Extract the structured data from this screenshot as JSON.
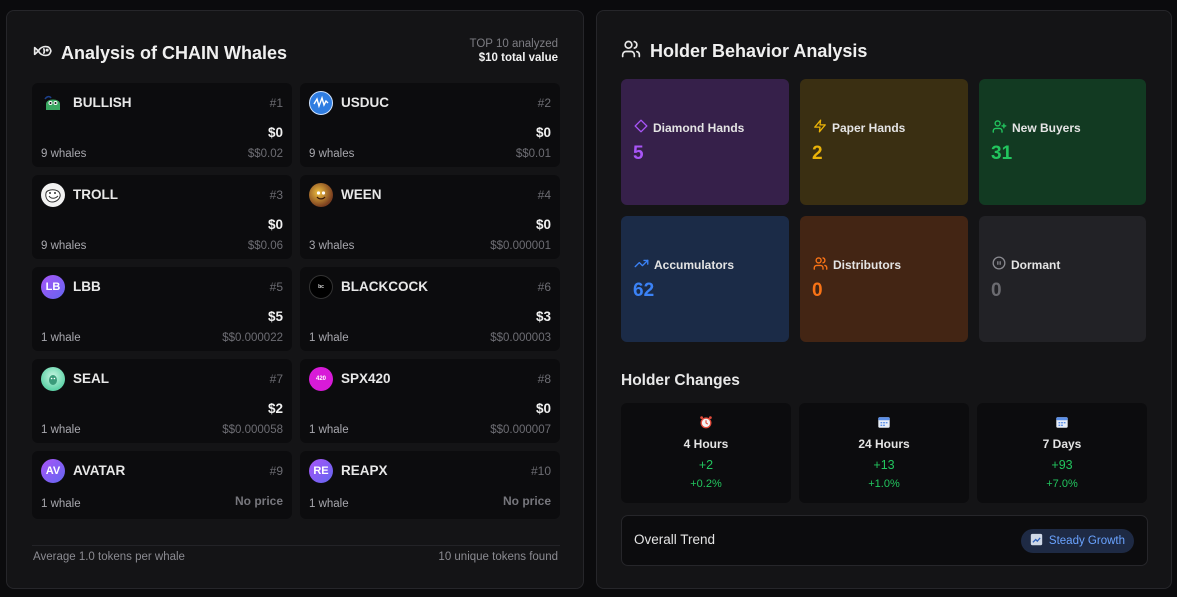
{
  "whales": {
    "title": "Analysis of CHAIN Whales",
    "meta_top": "TOP 10 analyzed",
    "meta_total": "$10 total value",
    "tokens": [
      {
        "symbol": "BULLISH",
        "rank": "#1",
        "value": "$0",
        "whales": "9 whales",
        "price": "$$0.02",
        "icon": "bullish-avatar-icon",
        "color": "#1f6f3a"
      },
      {
        "symbol": "USDUC",
        "rank": "#2",
        "value": "$0",
        "whales": "9 whales",
        "price": "$$0.01",
        "icon": "usduc-wave-icon",
        "color": "#2f7de1"
      },
      {
        "symbol": "TROLL",
        "rank": "#3",
        "value": "$0",
        "whales": "9 whales",
        "price": "$$0.06",
        "icon": "troll-face-icon",
        "color": "#dddddd"
      },
      {
        "symbol": "WEEN",
        "rank": "#4",
        "value": "$0",
        "whales": "3 whales",
        "price": "$$0.000001",
        "icon": "ween-face-icon",
        "color": "#7a3e1f"
      },
      {
        "symbol": "LBB",
        "rank": "#5",
        "value": "$5",
        "whales": "1 whale",
        "price": "$$0.000022",
        "icon": "initials-avatar-icon",
        "initials": "LB",
        "color": "#8b5cf6"
      },
      {
        "symbol": "BLACKCOCK",
        "rank": "#6",
        "value": "$3",
        "whales": "1 whale",
        "price": "$$0.000003",
        "icon": "blackcock-logo-icon",
        "color": "#000000"
      },
      {
        "symbol": "SEAL",
        "rank": "#7",
        "value": "$2",
        "whales": "1 whale",
        "price": "$$0.000058",
        "icon": "seal-avatar-icon",
        "color": "#5fd3a8"
      },
      {
        "symbol": "SPX420",
        "rank": "#8",
        "value": "$0",
        "whales": "1 whale",
        "price": "$$0.000007",
        "icon": "spx420-logo-icon",
        "color": "#d81bd8"
      },
      {
        "symbol": "AVATAR",
        "rank": "#9",
        "whales": "1 whale",
        "noprice": "No price",
        "icon": "initials-avatar-icon",
        "initials": "AV",
        "color": "#8b5cf6"
      },
      {
        "symbol": "REAPX",
        "rank": "#10",
        "whales": "1 whale",
        "noprice": "No price",
        "icon": "initials-avatar-icon",
        "initials": "RE",
        "color": "#8b5cf6"
      }
    ],
    "footer_left": "Average 1.0 tokens per whale",
    "footer_right": "10 unique tokens found"
  },
  "behavior": {
    "title": "Holder Behavior Analysis",
    "cards": [
      {
        "label": "Diamond Hands",
        "value": "5",
        "icon": "diamond-icon",
        "bg": "#36204a",
        "color": "#a855f7"
      },
      {
        "label": "Paper Hands",
        "value": "2",
        "icon": "lightning-icon",
        "bg": "#3a2f12",
        "color": "#eab308"
      },
      {
        "label": "New Buyers",
        "value": "31",
        "icon": "user-plus-icon",
        "bg": "#123a22",
        "color": "#22c55e"
      },
      {
        "label": "Accumulators",
        "value": "62",
        "icon": "trending-up-icon",
        "bg": "#1b2b47",
        "color": "#3b82f6"
      },
      {
        "label": "Distributors",
        "value": "0",
        "icon": "users-icon",
        "bg": "#432514",
        "color": "#f97316"
      },
      {
        "label": "Dormant",
        "value": "0",
        "icon": "pause-circle-icon",
        "bg": "#222226",
        "color": "#6b6b70"
      }
    ]
  },
  "changes": {
    "title": "Holder Changes",
    "items": [
      {
        "label": "4 Hours",
        "value": "+2",
        "pct": "+0.2%",
        "icon": "alarm-clock-icon"
      },
      {
        "label": "24 Hours",
        "value": "+13",
        "pct": "+1.0%",
        "icon": "calendar-icon"
      },
      {
        "label": "7 Days",
        "value": "+93",
        "pct": "+7.0%",
        "icon": "calendar-icon"
      }
    ]
  },
  "trend": {
    "label": "Overall Trend",
    "badge": "Steady Growth",
    "badge_icon": "chart-up-icon"
  }
}
